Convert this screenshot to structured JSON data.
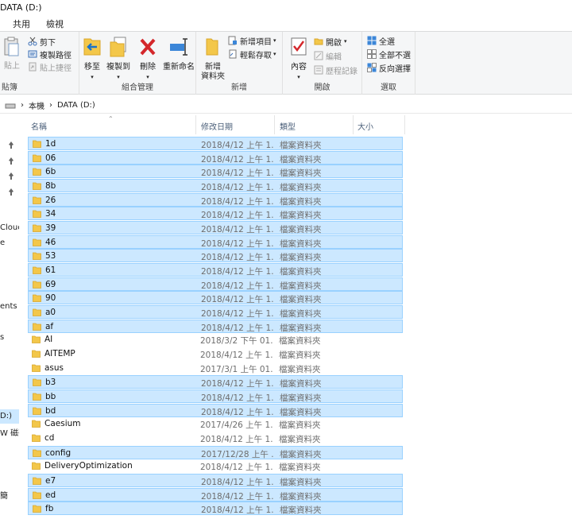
{
  "window": {
    "title": "DATA (D:)"
  },
  "menu": {
    "tabs": [
      "共用",
      "檢視"
    ]
  },
  "ribbon": {
    "clipboard": {
      "paste": "貼上",
      "cut": "剪下",
      "copy_path": "複製路徑",
      "paste_shortcut": "貼上捷徑",
      "label": "貼簿"
    },
    "organize": {
      "move_to": "移至",
      "copy_to": "複製到",
      "delete": "刪除",
      "rename": "重新命名",
      "label": "組合管理"
    },
    "new": {
      "new_folder_line1": "新增",
      "new_folder_line2": "資料夾",
      "new_item": "新增項目",
      "easy_access": "輕鬆存取",
      "label": "新增"
    },
    "open": {
      "properties": "內容",
      "open": "開啟",
      "edit": "編輯",
      "history": "歷程記錄",
      "label": "開啟"
    },
    "select": {
      "select_all": "全選",
      "select_none": "全部不選",
      "invert": "反向選擇",
      "label": "選取"
    }
  },
  "address": {
    "crumbs": [
      "本機",
      "DATA (D:)"
    ]
  },
  "nav": {
    "items": [
      "Clouc",
      "e",
      "ents",
      "s",
      "D:)",
      "W 磁碟",
      "簡"
    ]
  },
  "columns": {
    "name": "名稱",
    "date": "修改日期",
    "type": "類型",
    "size": "大小"
  },
  "files": [
    {
      "name": "1d",
      "date": "2018/4/12 上午 1...",
      "type": "檔案資料夾",
      "selected": true
    },
    {
      "name": "06",
      "date": "2018/4/12 上午 1...",
      "type": "檔案資料夾",
      "selected": true
    },
    {
      "name": "6b",
      "date": "2018/4/12 上午 1...",
      "type": "檔案資料夾",
      "selected": true
    },
    {
      "name": "8b",
      "date": "2018/4/12 上午 1...",
      "type": "檔案資料夾",
      "selected": true
    },
    {
      "name": "26",
      "date": "2018/4/12 上午 1...",
      "type": "檔案資料夾",
      "selected": true
    },
    {
      "name": "34",
      "date": "2018/4/12 上午 1...",
      "type": "檔案資料夾",
      "selected": true
    },
    {
      "name": "39",
      "date": "2018/4/12 上午 1...",
      "type": "檔案資料夾",
      "selected": true
    },
    {
      "name": "46",
      "date": "2018/4/12 上午 1...",
      "type": "檔案資料夾",
      "selected": true
    },
    {
      "name": "53",
      "date": "2018/4/12 上午 1...",
      "type": "檔案資料夾",
      "selected": true
    },
    {
      "name": "61",
      "date": "2018/4/12 上午 1...",
      "type": "檔案資料夾",
      "selected": true
    },
    {
      "name": "69",
      "date": "2018/4/12 上午 1...",
      "type": "檔案資料夾",
      "selected": true
    },
    {
      "name": "90",
      "date": "2018/4/12 上午 1...",
      "type": "檔案資料夾",
      "selected": true
    },
    {
      "name": "a0",
      "date": "2018/4/12 上午 1...",
      "type": "檔案資料夾",
      "selected": true
    },
    {
      "name": "af",
      "date": "2018/4/12 上午 1...",
      "type": "檔案資料夾",
      "selected": true
    },
    {
      "name": "AI",
      "date": "2018/3/2 下午 01...",
      "type": "檔案資料夾",
      "selected": false
    },
    {
      "name": "AITEMP",
      "date": "2018/4/12 上午 1...",
      "type": "檔案資料夾",
      "selected": false
    },
    {
      "name": "asus",
      "date": "2017/3/1 上午 01...",
      "type": "檔案資料夾",
      "selected": false
    },
    {
      "name": "b3",
      "date": "2018/4/12 上午 1...",
      "type": "檔案資料夾",
      "selected": true
    },
    {
      "name": "bb",
      "date": "2018/4/12 上午 1...",
      "type": "檔案資料夾",
      "selected": true
    },
    {
      "name": "bd",
      "date": "2018/4/12 上午 1...",
      "type": "檔案資料夾",
      "selected": true
    },
    {
      "name": "Caesium",
      "date": "2017/4/26 上午 1...",
      "type": "檔案資料夾",
      "selected": false
    },
    {
      "name": "cd",
      "date": "2018/4/12 上午 1...",
      "type": "檔案資料夾",
      "selected": false
    },
    {
      "name": "config",
      "date": "2017/12/28 上午 ...",
      "type": "檔案資料夾",
      "selected": true
    },
    {
      "name": "DeliveryOptimization",
      "date": "2018/4/12 上午 1...",
      "type": "檔案資料夾",
      "selected": false
    },
    {
      "name": "e7",
      "date": "2018/4/12 上午 1...",
      "type": "檔案資料夾",
      "selected": true
    },
    {
      "name": "ed",
      "date": "2018/4/12 上午 1...",
      "type": "檔案資料夾",
      "selected": true
    },
    {
      "name": "fb",
      "date": "2018/4/12 上午 1...",
      "type": "檔案資料夾",
      "selected": true
    }
  ],
  "colors": {
    "selection_bg": "#cce8ff",
    "selection_border": "#99d1ff",
    "folder": "#f3c74a",
    "accent": "#1a73c8"
  }
}
